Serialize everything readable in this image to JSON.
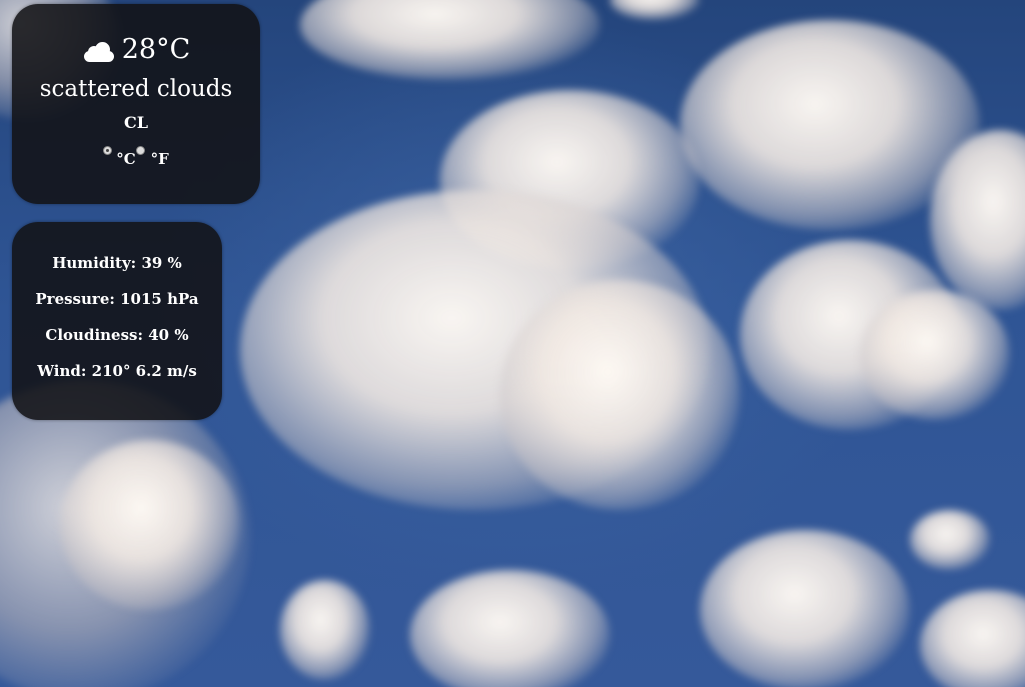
{
  "weather": {
    "icon": "cloud-icon",
    "temperature": "28°C",
    "description": "scattered clouds",
    "country": "CL"
  },
  "units": {
    "celsius_label": "°C",
    "fahrenheit_label": "°F",
    "selected": "celsius"
  },
  "details": {
    "humidity": "Humidity: 39 %",
    "pressure": "Pressure: 1015 hPa",
    "cloudiness": "Cloudiness: 40 %",
    "wind": "Wind: 210° 6.2 m/s"
  },
  "colors": {
    "panel_background": "#121216",
    "text": "#ffffff",
    "sky": "#2c4e86"
  }
}
